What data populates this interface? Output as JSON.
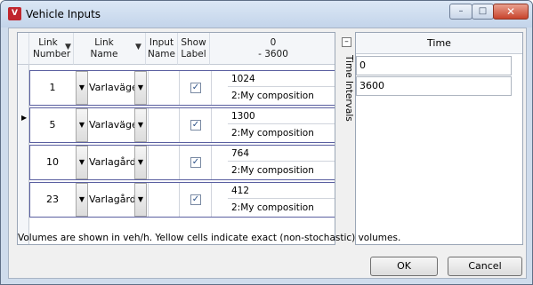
{
  "window": {
    "title": "Vehicle Inputs",
    "minimize": "–",
    "maximize": "□",
    "close": "✕",
    "app_icon": "vissim-icon"
  },
  "grid": {
    "headers": {
      "link_number": "Link Number",
      "link_name": "Link Name",
      "input_name": "Input Name",
      "show_label": "Show Label",
      "interval_top": "0",
      "interval_bottom": "- 3600"
    },
    "rows": [
      {
        "link": "1",
        "name": "Varlavägen",
        "volume": "1024",
        "composition": "2:My composition",
        "show_label": true
      },
      {
        "link": "5",
        "name": "Varlavägen",
        "volume": "1300",
        "composition": "2:My composition",
        "show_label": true
      },
      {
        "link": "10",
        "name": "Varlagård",
        "volume": "764",
        "composition": "2:My composition",
        "show_label": true
      },
      {
        "link": "23",
        "name": "Varlagård",
        "volume": "412",
        "composition": "2:My composition",
        "show_label": true
      }
    ]
  },
  "time_intervals": {
    "label": "Time Intervals",
    "collapse": "–",
    "header": "Time",
    "values": [
      "0",
      "3600"
    ]
  },
  "info_text": "Volumes are shown in veh/h. Yellow cells indicate exact (non-stochastic) volumes.",
  "buttons": {
    "ok": "OK",
    "cancel": "Cancel"
  }
}
